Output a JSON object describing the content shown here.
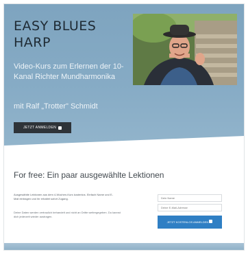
{
  "hero": {
    "title": "EASY BLUES HARP",
    "subtitle": "Video-Kurs zum Erlernen der 10-Kanal Richter Mundharmonika",
    "author_line": "mit Ralf „Trotter\" Schmidt",
    "cta_label": "JETZT ANMELDEN",
    "cta_icon": "lock-icon"
  },
  "lessons": {
    "heading": "For free: Ein paar ausgewählte Lektionen",
    "description": "Ausgewählte Lektionen aus dem 4-Wochen-Kurs kostenlos. Einfach Name und E-Mail eintragen und ihr erhaltet sofort Zugang.",
    "note": "Deine Daten werden vertraulich behandelt und nicht an Dritte weitergegeben. Du kannst dich jederzeit wieder austragen.",
    "name_placeholder": "Dein Name",
    "email_placeholder": "Deine E-Mail-Adresse",
    "submit_label": "JETZT KOSTENLOS ANMELDEN"
  },
  "colors": {
    "hero_blue": "#86abc5",
    "cta_dark": "#2e3338",
    "cta_blue": "#2f7fc4"
  }
}
